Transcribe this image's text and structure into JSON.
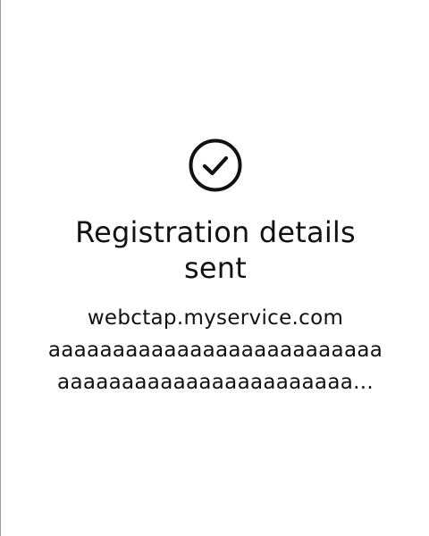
{
  "dialog": {
    "icon": "check-circle-icon",
    "title_line1": "Registration details",
    "title_line2": "sent",
    "site": "webctap.myservice.com",
    "account_line1": "aaaaaaaaaaaaaaaaaaaaaaaaaa",
    "account_line2": "aaaaaaaaaaaaaaaaaaaaaaa...",
    "text_color": "#111111",
    "background": "#ffffff"
  }
}
